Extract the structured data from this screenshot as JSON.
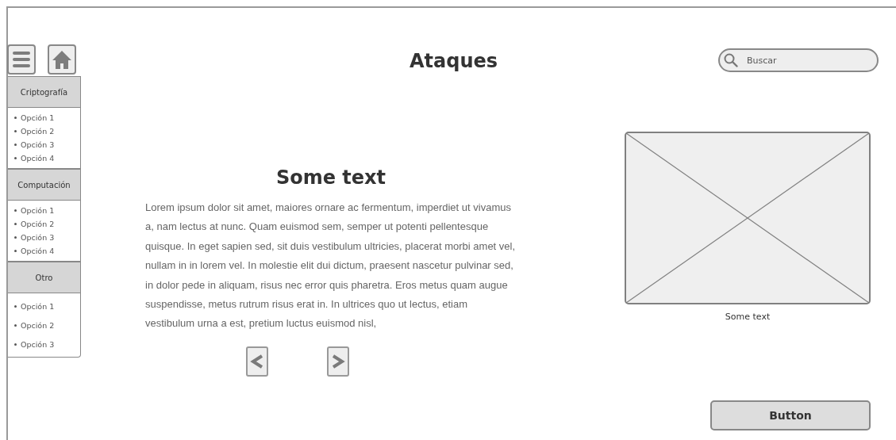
{
  "toolbar": {
    "buttons": [
      {
        "kind": "menu"
      },
      {
        "kind": "home"
      }
    ]
  },
  "sidebar": {
    "sections": [
      {
        "title": "Criptografía",
        "items": [
          "Opción 1",
          "Opción 2",
          "Opción 3",
          "Opción 4"
        ]
      },
      {
        "title": "Computación",
        "items": [
          "Opción 1",
          "Opción 2",
          "Opción 3",
          "Opción 4"
        ]
      },
      {
        "title": "Otro",
        "items": [
          "Opción 1",
          "Opción 2",
          "Opción 3"
        ]
      }
    ]
  },
  "header": {
    "title": "Ataques",
    "search": {
      "placeholder": "Buscar"
    }
  },
  "content": {
    "heading": "Some text",
    "paragraph": "Lorem ipsum dolor sit amet, maiores ornare ac fermentum, imperdiet ut vivamus a, nam lectus at nunc. Quam euismod sem, semper ut potenti pellentesque quisque. In eget sapien sed, sit duis vestibulum ultricies, placerat morbi amet vel, nullam in in lorem vel. In molestie elit dui dictum, praesent nascetur pulvinar sed, in dolor pede in aliquam, risus nec error quis pharetra. Eros metus quam augue suspendisse, metus rutrum risus erat in.  In ultrices quo ut lectus, etiam vestibulum urna a est, pretium luctus euismod nisl,",
    "nav": [
      {
        "kind": "prev"
      },
      {
        "kind": "next"
      }
    ]
  },
  "image": {
    "kind": "picture",
    "caption": "Some text"
  },
  "action_button": "Button"
}
